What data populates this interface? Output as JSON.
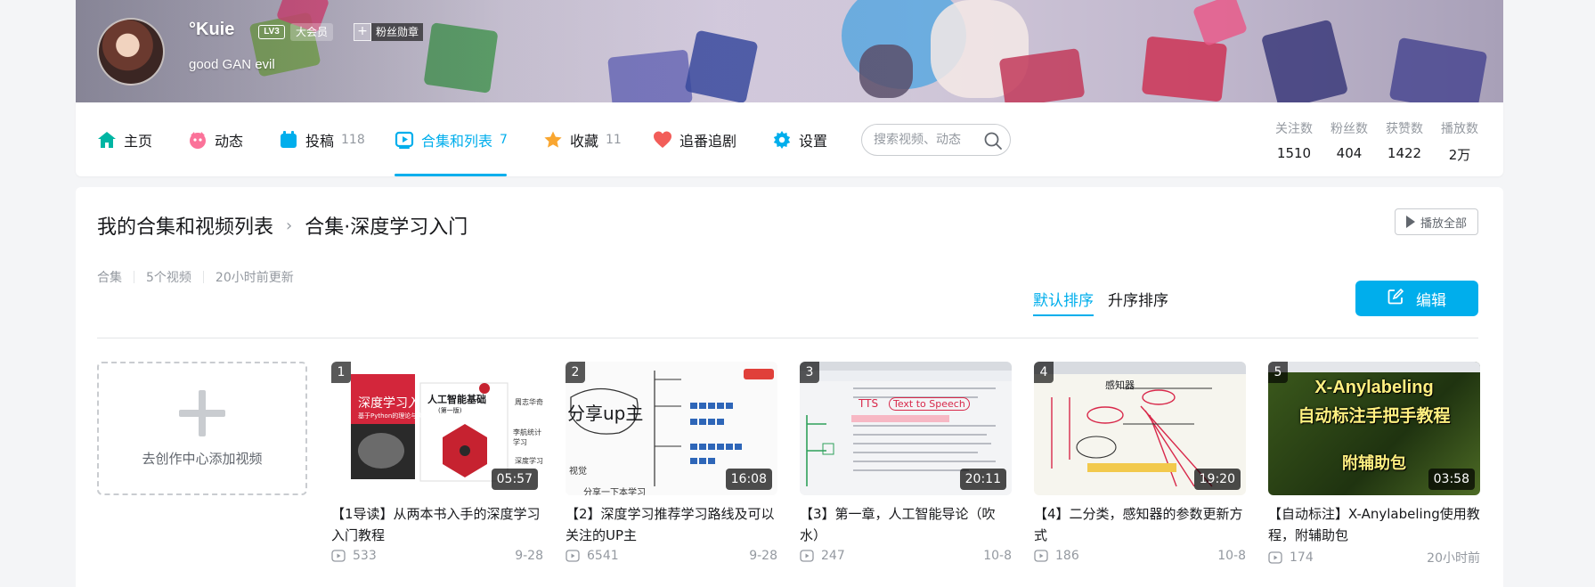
{
  "profile": {
    "name": "°Kuie",
    "level": "LV3",
    "vip": "大会员",
    "fan_badge_plus": "+",
    "fan_badge": "粉丝勋章",
    "sign": "good GAN evil"
  },
  "nav": {
    "items": [
      {
        "label": "主页",
        "count": "",
        "icon": "home-icon",
        "color": "#00b5a3"
      },
      {
        "label": "动态",
        "count": "",
        "icon": "dynamic-icon",
        "color": "#fb7299"
      },
      {
        "label": "投稿",
        "count": "118",
        "icon": "upload-icon",
        "color": "#00aeec"
      },
      {
        "label": "合集和列表",
        "count": "7",
        "icon": "collection-icon",
        "color": "#00aeec"
      },
      {
        "label": "收藏",
        "count": "11",
        "icon": "star-icon",
        "color": "#f9a630"
      },
      {
        "label": "追番追剧",
        "count": "",
        "icon": "heart-icon",
        "color": "#f25d59"
      },
      {
        "label": "设置",
        "count": "",
        "icon": "gear-icon",
        "color": "#00aeec"
      }
    ],
    "active_index": 3,
    "search_placeholder": "搜索视频、动态",
    "stats": [
      {
        "label": "关注数",
        "value": "1510"
      },
      {
        "label": "粉丝数",
        "value": "404"
      },
      {
        "label": "获赞数",
        "value": "1422"
      },
      {
        "label": "播放数",
        "value": "2万"
      }
    ]
  },
  "main": {
    "crumb_root": "我的合集和视频列表",
    "crumb_current": "合集·深度学习入门",
    "play_all": "播放全部",
    "meta": [
      "合集",
      "5个视频",
      "20小时前更新"
    ],
    "sort_default": "默认排序",
    "sort_asc": "升序排序",
    "edit": "编辑",
    "add_label": "去创作中心添加视频",
    "videos": [
      {
        "index": "1",
        "duration": "05:57",
        "title": "【1导读】从两本书入手的深度学习入门教程",
        "plays": "533",
        "date": "9-28"
      },
      {
        "index": "2",
        "duration": "16:08",
        "title": "【2】深度学习推荐学习路线及可以关注的UP主",
        "plays": "6541",
        "date": "9-28"
      },
      {
        "index": "3",
        "duration": "20:11",
        "title": "【3】第一章，人工智能导论（吹水）",
        "plays": "247",
        "date": "10-8"
      },
      {
        "index": "4",
        "duration": "19:20",
        "title": "【4】二分类，感知器的参数更新方式",
        "plays": "186",
        "date": "10-8"
      },
      {
        "index": "5",
        "duration": "03:58",
        "title": "【自动标注】X-Anylabeling使用教程，附辅助包",
        "plays": "174",
        "date": "20小时前"
      }
    ],
    "thumb_text": {
      "t1_book1": "深度学习入门",
      "t1_book1_sub": "基于Python的理论与实现",
      "t1_book2": "人工智能基础",
      "t1_book2_sub": "(第一版)",
      "t1_side1": "周志华奇",
      "t1_side2": "李航统计学习",
      "t1_side3": "深度学习",
      "t2_big": "分享up主",
      "t2_small": "视觉",
      "t2_bottom": "分享一下本学习",
      "t3_tts": "TTS",
      "t3_tts2": "Text to Speech",
      "t4_top": "感知器",
      "t5_line1": "X-Anylabeling",
      "t5_line2": "自动标注手把手教程",
      "t5_line3": "附辅助包"
    }
  }
}
